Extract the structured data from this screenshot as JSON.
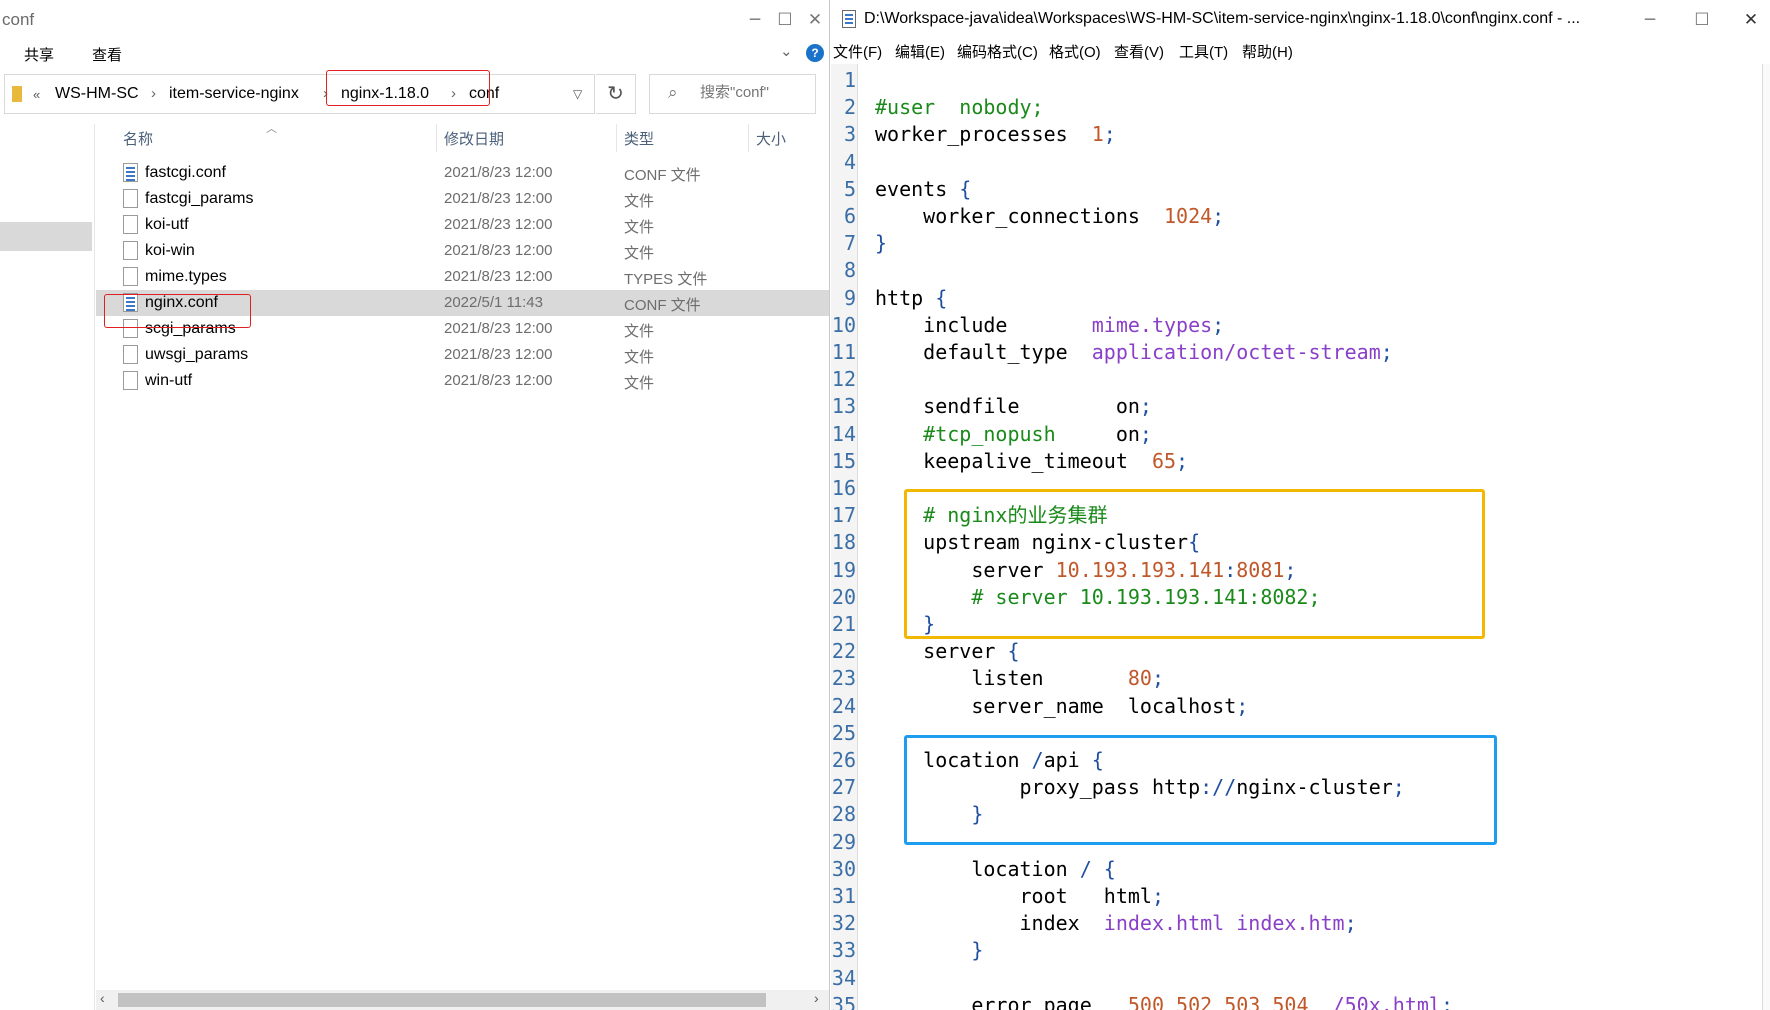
{
  "explorer": {
    "title": "conf",
    "ribbon": [
      "共享",
      "查看"
    ],
    "help": "?",
    "breadcrumbs": [
      "WS-HM-SC",
      "item-service-nginx",
      "nginx-1.18.0",
      "conf"
    ],
    "breadcrumb_prefix": "«",
    "search_placeholder": "搜索\"conf\"",
    "columns": [
      "名称",
      "修改日期",
      "类型",
      "大小"
    ],
    "files": [
      {
        "name": "fastcgi.conf",
        "date": "2021/8/23 12:00",
        "type": "CONF 文件",
        "icon": "conf-file-icon"
      },
      {
        "name": "fastcgi_params",
        "date": "2021/8/23 12:00",
        "type": "文件",
        "icon": "file-icon"
      },
      {
        "name": "koi-utf",
        "date": "2021/8/23 12:00",
        "type": "文件",
        "icon": "file-icon"
      },
      {
        "name": "koi-win",
        "date": "2021/8/23 12:00",
        "type": "文件",
        "icon": "file-icon"
      },
      {
        "name": "mime.types",
        "date": "2021/8/23 12:00",
        "type": "TYPES 文件",
        "icon": "file-icon"
      },
      {
        "name": "nginx.conf",
        "date": "2022/5/1 11:43",
        "type": "CONF 文件",
        "icon": "conf-file-icon",
        "selected": true
      },
      {
        "name": "scgi_params",
        "date": "2021/8/23 12:00",
        "type": "文件",
        "icon": "file-icon"
      },
      {
        "name": "uwsgi_params",
        "date": "2021/8/23 12:00",
        "type": "文件",
        "icon": "file-icon"
      },
      {
        "name": "win-utf",
        "date": "2021/8/23 12:00",
        "type": "文件",
        "icon": "file-icon"
      }
    ]
  },
  "editor": {
    "title": "D:\\Workspace-java\\idea\\Workspaces\\WS-HM-SC\\item-service-nginx\\nginx-1.18.0\\conf\\nginx.conf - ...",
    "menu": [
      "文件(F)",
      "编辑(E)",
      "编码格式(C)",
      "格式(O)",
      "查看(V)",
      "工具(T)",
      "帮助(H)"
    ],
    "line_numbers": [
      "1",
      "2",
      "3",
      "4",
      "5",
      "6",
      "7",
      "8",
      "9",
      "10",
      "11",
      "12",
      "13",
      "14",
      "15",
      "16",
      "17",
      "18",
      "19",
      "20",
      "21",
      "22",
      "23",
      "24",
      "25",
      "26",
      "27",
      "28",
      "29",
      "30",
      "31",
      "32",
      "33",
      "34",
      "35"
    ],
    "lines": [
      [],
      [
        [
          "#user  nobody;",
          "comment"
        ]
      ],
      [
        [
          "worker_processes  ",
          "plain"
        ],
        [
          "1",
          "number"
        ],
        [
          ";",
          "punct"
        ]
      ],
      [],
      [
        [
          "events ",
          "plain"
        ],
        [
          "{",
          "punct"
        ]
      ],
      [
        [
          "    worker_connections  ",
          "plain"
        ],
        [
          "1024",
          "number"
        ],
        [
          ";",
          "punct"
        ]
      ],
      [
        [
          "}",
          "punct"
        ]
      ],
      [],
      [
        [
          "http ",
          "plain"
        ],
        [
          "{",
          "punct"
        ]
      ],
      [
        [
          "    include       ",
          "plain"
        ],
        [
          "mime.types",
          "value"
        ],
        [
          ";",
          "punct"
        ]
      ],
      [
        [
          "    default_type  ",
          "plain"
        ],
        [
          "application/octet-stream",
          "value"
        ],
        [
          ";",
          "punct"
        ]
      ],
      [],
      [
        [
          "    sendfile        on",
          "plain"
        ],
        [
          ";",
          "punct"
        ]
      ],
      [
        [
          "    #tcp_nopush     ",
          "comment"
        ],
        [
          "on",
          "plain"
        ],
        [
          ";",
          "punct"
        ]
      ],
      [
        [
          "    keepalive_timeout  ",
          "plain"
        ],
        [
          "65",
          "number"
        ],
        [
          ";",
          "punct"
        ]
      ],
      [],
      [
        [
          "    # nginx的业务集群",
          "comment"
        ]
      ],
      [
        [
          "    upstream nginx-cluster",
          "plain"
        ],
        [
          "{",
          "punct"
        ]
      ],
      [
        [
          "        server ",
          "plain"
        ],
        [
          "10.193.193.141",
          "number"
        ],
        [
          ":",
          "punct"
        ],
        [
          "8081",
          "number"
        ],
        [
          ";",
          "punct"
        ]
      ],
      [
        [
          "        # server 10.193.193.141:8082;",
          "comment"
        ]
      ],
      [
        [
          "    ",
          "plain"
        ],
        [
          "}",
          "punct"
        ]
      ],
      [
        [
          "    server ",
          "plain"
        ],
        [
          "{",
          "punct"
        ]
      ],
      [
        [
          "        listen       ",
          "plain"
        ],
        [
          "80",
          "number"
        ],
        [
          ";",
          "punct"
        ]
      ],
      [
        [
          "        server_name  localhost",
          "plain"
        ],
        [
          ";",
          "punct"
        ]
      ],
      [],
      [
        [
          "    location ",
          "plain"
        ],
        [
          "/",
          "punct"
        ],
        [
          "api ",
          "plain"
        ],
        [
          "{",
          "punct"
        ]
      ],
      [
        [
          "            proxy_pass http",
          "plain"
        ],
        [
          ":",
          "punct"
        ],
        [
          "//",
          "punct"
        ],
        [
          "nginx-cluster",
          "plain"
        ],
        [
          ";",
          "punct"
        ]
      ],
      [
        [
          "        ",
          "plain"
        ],
        [
          "}",
          "punct"
        ]
      ],
      [],
      [
        [
          "        location ",
          "plain"
        ],
        [
          "/",
          "punct"
        ],
        [
          " ",
          "plain"
        ],
        [
          "{",
          "punct"
        ]
      ],
      [
        [
          "            root   html",
          "plain"
        ],
        [
          ";",
          "punct"
        ]
      ],
      [
        [
          "            index  ",
          "plain"
        ],
        [
          "index.html index.htm",
          "value"
        ],
        [
          ";",
          "punct"
        ]
      ],
      [
        [
          "        ",
          "plain"
        ],
        [
          "}",
          "punct"
        ]
      ],
      [],
      [
        [
          "        error_page   ",
          "plain"
        ],
        [
          "500 502 503 504",
          "number"
        ],
        [
          "  ",
          "plain"
        ],
        [
          "/50x.html",
          "value"
        ],
        [
          ";",
          "punct"
        ]
      ]
    ]
  },
  "colors": {
    "comment": "#1a8a1a",
    "number": "#c0582a",
    "value": "#8a3fc8",
    "punct": "#1f4fa0",
    "plain": "#000000",
    "highlight_red": "#e02020",
    "highlight_yellow": "#f2b800",
    "highlight_blue": "#1e9cf0"
  }
}
